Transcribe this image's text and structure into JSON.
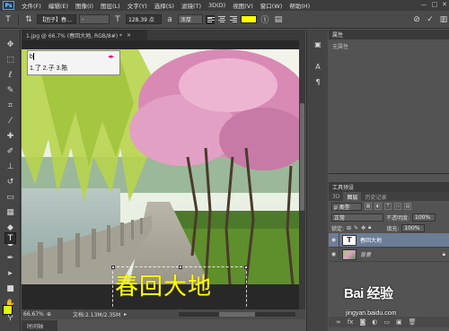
{
  "app": {
    "logo": "Ps"
  },
  "menu": [
    "文件(F)",
    "编辑(E)",
    "图像(I)",
    "图层(L)",
    "文字(Y)",
    "选择(S)",
    "滤镜(T)",
    "3D(D)",
    "视图(V)",
    "窗口(W)",
    "帮助(H)"
  ],
  "window_controls": {
    "min": "—",
    "max": "□",
    "close": "✕"
  },
  "options": {
    "font_family": "【团子】春…",
    "font_style": "-",
    "font_size": "128.39 点",
    "antialias": "浑厚",
    "text_color": "#ffff00"
  },
  "document": {
    "tab_title": "1.jpg @ 66.7% (春回大地, RGB/8#) *",
    "tab_close": "×",
    "zoom": "66.67%",
    "doc_info": "文档:2.13M/2.35M",
    "timeline": "时间轴"
  },
  "ime": {
    "input": "b",
    "candidates": "1.了 2.子 3.陈",
    "indicator": "◂▸"
  },
  "canvas_text": "春回大地",
  "properties_panel": {
    "title": "属性",
    "body": "无属性"
  },
  "layers_panel": {
    "header": "工具预设",
    "tabs": [
      "3D",
      "图层",
      "历史记录"
    ],
    "kind_label": "ρ 类型",
    "blend_mode": "正常",
    "opacity_label": "不透明度:",
    "opacity": "100%",
    "lock_label": "锁定:",
    "fill_label": "填充:",
    "fill": "100%",
    "layers": [
      {
        "name": "春回大地",
        "thumb": "T",
        "selected": true
      },
      {
        "name": "背景",
        "thumb": "image",
        "selected": false
      }
    ]
  },
  "watermark": {
    "brand": "Bai 经验",
    "url": "jingyan.baidu.com"
  },
  "colors": {
    "foreground": "#dcff00",
    "background": "#ffffff",
    "accent": "#6c7d96"
  }
}
